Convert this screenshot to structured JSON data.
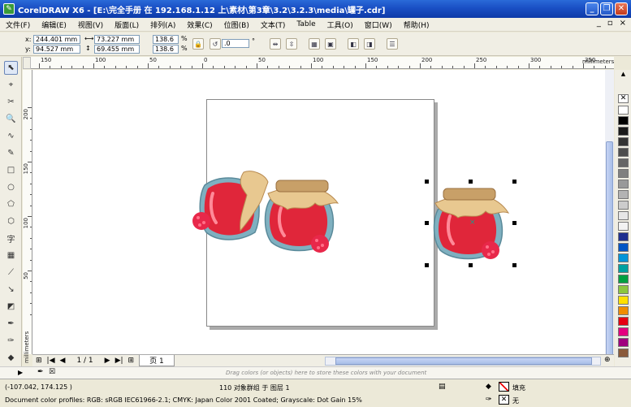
{
  "window": {
    "title": "CorelDRAW X6 - [E:\\完全手册 在 192.168.1.12 上\\素材\\第3章\\3.2\\3.2.3\\media\\罐子.cdr]",
    "minimize": "_",
    "restore": "❐",
    "close": "✕"
  },
  "menu": [
    "文件(F)",
    "编辑(E)",
    "视图(V)",
    "版面(L)",
    "排列(A)",
    "效果(C)",
    "位图(B)",
    "文本(T)",
    "Table",
    "工具(O)",
    "窗口(W)",
    "帮助(H)"
  ],
  "mdi_controls": [
    "_",
    "▫",
    "×"
  ],
  "props": {
    "x_label": "x:",
    "x_value": "244.401 mm",
    "y_label": "y:",
    "y_value": "94.527 mm",
    "w_value": "73.227 mm",
    "h_value": "69.455 mm",
    "scale_x": "138.6",
    "scale_y": "138.6",
    "pct": "%",
    "angle": ".0",
    "deg": "°"
  },
  "ruler": {
    "unit": "millimeters",
    "h_ticks": [
      "150",
      "100",
      "50",
      "0",
      "50",
      "100",
      "150",
      "200",
      "250",
      "300",
      "350"
    ],
    "v_ticks": [
      "200",
      "150",
      "100",
      "50"
    ]
  },
  "page_nav": {
    "counter": "1 / 1",
    "tab": "页 1"
  },
  "hint": "Drag colors (or objects) here to store these colors with your document",
  "status": {
    "coords": "(-107.042, 174.125 )",
    "selection": "110 对象群组 于 图层 1",
    "profiles": "Document color profiles: RGB: sRGB IEC61966-2.1; CMYK: Japan Color 2001 Coated; Grayscale: Dot Gain 15%",
    "fill_label": "填充",
    "outline_label": "无"
  },
  "palette": [
    "#ffffff",
    "#000000",
    "#1a1a1a",
    "#333333",
    "#4d4d4d",
    "#666666",
    "#808080",
    "#999999",
    "#b3b3b3",
    "#cccccc",
    "#e6e6e6",
    "#f2f2f2",
    "#1f2f8f",
    "#0055c4",
    "#0094d8",
    "#00a0a0",
    "#00a040",
    "#8cc63f",
    "#ffe000",
    "#f08c00",
    "#e60012",
    "#e4007f",
    "#a0007e",
    "#8a5a3a"
  ]
}
